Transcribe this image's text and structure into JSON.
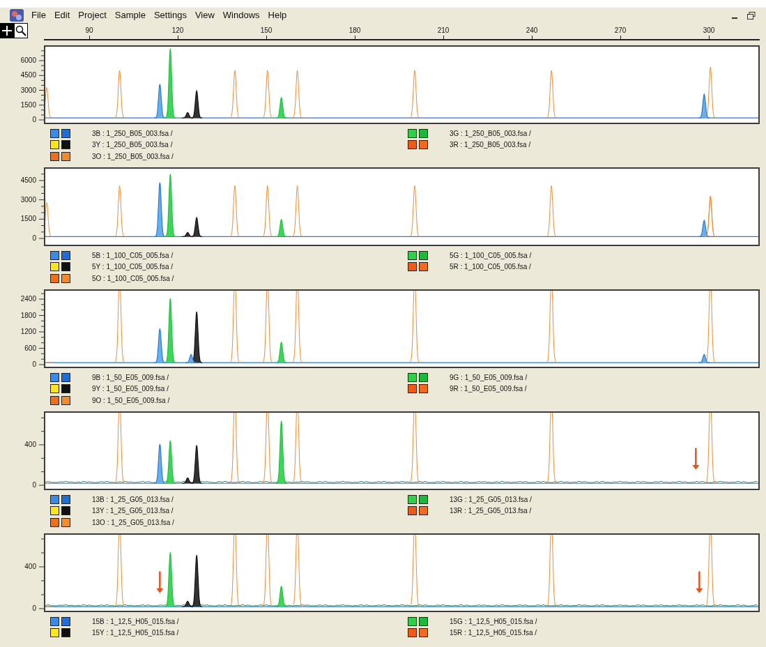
{
  "menu_bar": {
    "items": [
      "File",
      "Edit",
      "Project",
      "Sample",
      "Settings",
      "View",
      "Windows",
      "Help"
    ]
  },
  "ruler": {
    "ticks": [
      "90",
      "120",
      "150",
      "180",
      "210",
      "240",
      "270",
      "300"
    ]
  },
  "panels": [
    {
      "y_ticks": [
        "6000",
        "4500",
        "3000",
        "1500",
        "0"
      ],
      "legend_left": [
        {
          "label": "3B : 1_250_B05_003.fsa /",
          "swatches": [
            {
              "color": "#3a8ae8"
            },
            {
              "color": "#1e6ed4"
            }
          ]
        },
        {
          "label": "3Y : 1_250_B05_003.fsa /",
          "swatches": [
            {
              "color": "#ffe61a"
            },
            {
              "color": "#111111"
            }
          ]
        },
        {
          "label": "3O : 1_250_B05_003.fsa /",
          "swatches": [
            {
              "color": "#f0701a"
            },
            {
              "color": "#f48a2e"
            }
          ]
        }
      ],
      "legend_right": [
        {
          "label": "3G : 1_250_B05_003.fsa /",
          "swatches": [
            {
              "color": "#2ed04a"
            },
            {
              "color": "#1cb83a"
            }
          ]
        },
        {
          "label": "3R : 1_250_B05_003.fsa /",
          "swatches": [
            {
              "color": "#ee5a18"
            },
            {
              "color": "#f06a22"
            }
          ]
        }
      ]
    },
    {
      "y_ticks": [
        "4500",
        "3000",
        "1500",
        "0"
      ],
      "legend_left": [
        {
          "label": "5B : 1_100_C05_005.fsa /",
          "swatches": [
            {
              "color": "#3a8ae8"
            },
            {
              "color": "#1e6ed4"
            }
          ]
        },
        {
          "label": "5Y : 1_100_C05_005.fsa /",
          "swatches": [
            {
              "color": "#ffe61a"
            },
            {
              "color": "#111111"
            }
          ]
        },
        {
          "label": "5O : 1_100_C05_005.fsa /",
          "swatches": [
            {
              "color": "#f0701a"
            },
            {
              "color": "#f48a2e"
            }
          ]
        }
      ],
      "legend_right": [
        {
          "label": "5G : 1_100_C05_005.fsa /",
          "swatches": [
            {
              "color": "#2ed04a"
            },
            {
              "color": "#1cb83a"
            }
          ]
        },
        {
          "label": "5R : 1_100_C05_005.fsa /",
          "swatches": [
            {
              "color": "#ee5a18"
            },
            {
              "color": "#f06a22"
            }
          ]
        }
      ]
    },
    {
      "y_ticks": [
        "2400",
        "1800",
        "1200",
        "600",
        "0"
      ],
      "legend_left": [
        {
          "label": "9B : 1_50_E05_009.fsa /",
          "swatches": [
            {
              "color": "#3a8ae8"
            },
            {
              "color": "#1e6ed4"
            }
          ]
        },
        {
          "label": "9Y : 1_50_E05_009.fsa /",
          "swatches": [
            {
              "color": "#ffe61a"
            },
            {
              "color": "#111111"
            }
          ]
        },
        {
          "label": "9O : 1_50_E05_009.fsa /",
          "swatches": [
            {
              "color": "#f0701a"
            },
            {
              "color": "#f48a2e"
            }
          ]
        }
      ],
      "legend_right": [
        {
          "label": "9G : 1_50_E05_009.fsa /",
          "swatches": [
            {
              "color": "#2ed04a"
            },
            {
              "color": "#1cb83a"
            }
          ]
        },
        {
          "label": "9R : 1_50_E05_009.fsa /",
          "swatches": [
            {
              "color": "#ee5a18"
            },
            {
              "color": "#f06a22"
            }
          ]
        }
      ]
    },
    {
      "y_ticks": [
        "400",
        "0"
      ],
      "legend_left": [
        {
          "label": "13B : 1_25_G05_013.fsa /",
          "swatches": [
            {
              "color": "#3a8ae8"
            },
            {
              "color": "#1e6ed4"
            }
          ]
        },
        {
          "label": "13Y : 1_25_G05_013.fsa /",
          "swatches": [
            {
              "color": "#ffe61a"
            },
            {
              "color": "#111111"
            }
          ]
        },
        {
          "label": "13O : 1_25_G05_013.fsa /",
          "swatches": [
            {
              "color": "#f0701a"
            },
            {
              "color": "#f48a2e"
            }
          ]
        }
      ],
      "legend_right": [
        {
          "label": "13G : 1_25_G05_013.fsa /",
          "swatches": [
            {
              "color": "#2ed04a"
            },
            {
              "color": "#1cb83a"
            }
          ]
        },
        {
          "label": "13R : 1_25_G05_013.fsa /",
          "swatches": [
            {
              "color": "#ee5a18"
            },
            {
              "color": "#f06a22"
            }
          ]
        }
      ]
    },
    {
      "y_ticks": [
        "400",
        "0"
      ],
      "legend_left": [
        {
          "label": "15B : 1_12,5_H05_015.fsa /",
          "swatches": [
            {
              "color": "#3a8ae8"
            },
            {
              "color": "#1e6ed4"
            }
          ]
        },
        {
          "label": "15Y : 1_12,5_H05_015.fsa /",
          "swatches": [
            {
              "color": "#ffe61a"
            },
            {
              "color": "#111111"
            }
          ]
        }
      ],
      "legend_right": [
        {
          "label": "15G : 1_12,5_H05_015.fsa /",
          "swatches": [
            {
              "color": "#2ed04a"
            },
            {
              "color": "#1cb83a"
            }
          ]
        },
        {
          "label": "15R : 1_12,5_H05_015.fsa /",
          "swatches": [
            {
              "color": "#ee5a18"
            },
            {
              "color": "#f06a22"
            }
          ]
        }
      ]
    }
  ]
}
